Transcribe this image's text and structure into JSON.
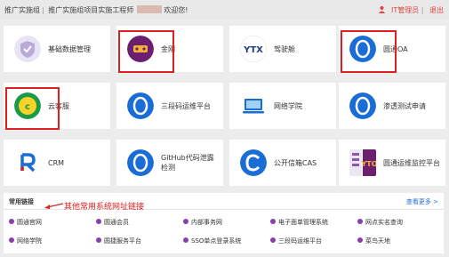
{
  "topbar": {
    "org": "推广实施组",
    "sep": "|",
    "role": "推广实施组项目实施工程师",
    "welcome": "欢迎您!",
    "user": "IT管理员",
    "logout": "退出"
  },
  "tiles": [
    {
      "label": "基础数据管理",
      "icon": "shield-icon"
    },
    {
      "label": "金刚",
      "icon": "jingang-logo-icon"
    },
    {
      "label": "驾驶舱",
      "icon": "cockpit-logo-icon"
    },
    {
      "label": "圆通OA",
      "icon": "oa-logo-icon"
    },
    {
      "label": "云客服",
      "icon": "cloud-service-logo-icon"
    },
    {
      "label": "三段码运维平台",
      "icon": "o-logo-icon"
    },
    {
      "label": "网络学院",
      "icon": "laptop-icon"
    },
    {
      "label": "渗透测试申请",
      "icon": "o-logo-icon"
    },
    {
      "label": "CRM",
      "icon": "crm-logo-icon"
    },
    {
      "label": "GitHub代码泄露检测",
      "icon": "o-logo-icon"
    },
    {
      "label": "公开信箱CAS",
      "icon": "c-logo-icon"
    },
    {
      "label": "圆通运维监控平台",
      "icon": "monitor-logo-icon"
    }
  ],
  "links_section": {
    "title": "常用链接",
    "more": "查看更多 >",
    "annotation": "其他常用系统网址链接",
    "items": [
      "圆通官网",
      "圆通会员",
      "内部事务网",
      "电子面单管理系统",
      "网点实名查询",
      "网络学院",
      "圆捷服务平台",
      "SSO单点登录系统",
      "三段码运维平台",
      "菜鸟天地"
    ]
  },
  "colors": {
    "accent_red": "#e02020",
    "brand_blue": "#1a6dd4",
    "link_dot": "#8a3fb0"
  }
}
